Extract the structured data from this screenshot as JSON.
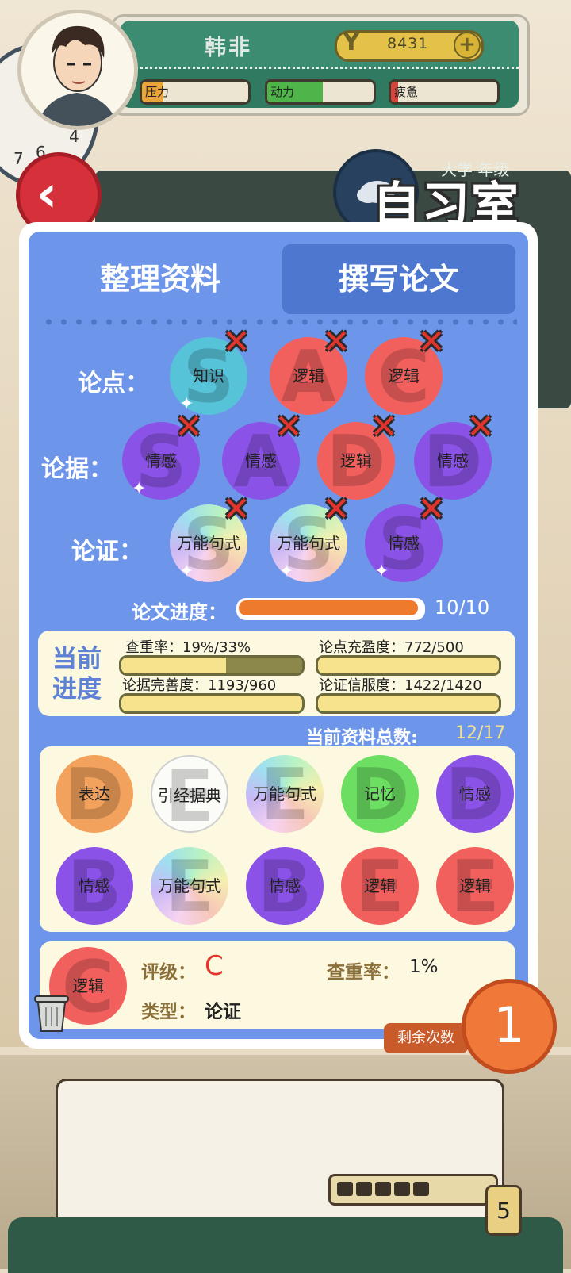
{
  "header": {
    "player_name": "韩非",
    "coin_symbol": "Y",
    "coins": "8431",
    "coin_plus": "+",
    "stats": [
      {
        "label": "压力",
        "color": "#e7a53a",
        "level": 0.2
      },
      {
        "label": "动力",
        "color": "#4fb54a",
        "level": 0.52
      },
      {
        "label": "疲惫",
        "color": "#d8443c",
        "level": 0.07
      }
    ]
  },
  "location": {
    "room": "自习室",
    "grade_text": "大学 年级"
  },
  "tabs": [
    {
      "label": "整理资料",
      "active": false
    },
    {
      "label": "撰写论文",
      "active": true
    }
  ],
  "essay": {
    "rows": [
      {
        "label": "论点：",
        "chips": [
          {
            "text": "知识",
            "grade": "S",
            "color": "cyan"
          },
          {
            "text": "逻辑",
            "grade": "A",
            "color": "red"
          },
          {
            "text": "逻辑",
            "grade": "C",
            "color": "red"
          }
        ]
      },
      {
        "label": "论据：",
        "chips": [
          {
            "text": "情感",
            "grade": "S",
            "color": "purple"
          },
          {
            "text": "情感",
            "grade": "A",
            "color": "purple"
          },
          {
            "text": "逻辑",
            "grade": "D",
            "color": "red"
          },
          {
            "text": "情感",
            "grade": "D",
            "color": "purple"
          }
        ]
      },
      {
        "label": "论证：",
        "chips": [
          {
            "text": "万能句式",
            "grade": "S",
            "color": "rainbow"
          },
          {
            "text": "万能句式",
            "grade": "S",
            "color": "rainbow"
          },
          {
            "text": "情感",
            "grade": "S",
            "color": "purple"
          }
        ]
      }
    ],
    "progress_label": "论文进度：",
    "progress_value": "10/10",
    "progress": 1.0
  },
  "current": {
    "title": "当前进度",
    "metrics": [
      {
        "label": "查重率：",
        "value": "19%/33%",
        "fill": 0.58
      },
      {
        "label": "论点充盈度：",
        "value": "772/500",
        "fill": 1.0
      },
      {
        "label": "论据完善度：",
        "value": "1193/960",
        "fill": 1.0
      },
      {
        "label": "论证信服度：",
        "value": "1422/1420",
        "fill": 1.0
      }
    ]
  },
  "materials": {
    "total_label": "当前资料总数:",
    "total_value": "12/17",
    "items": [
      {
        "text": "表达",
        "grade": "D",
        "color": "orange"
      },
      {
        "text": "引经据典",
        "grade": "E",
        "color": "white"
      },
      {
        "text": "万能句式",
        "grade": "E",
        "color": "rainbow"
      },
      {
        "text": "记忆",
        "grade": "D",
        "color": "green"
      },
      {
        "text": "情感",
        "grade": "D",
        "color": "purple"
      },
      {
        "text": "情感",
        "grade": "B",
        "color": "purple"
      },
      {
        "text": "万能句式",
        "grade": "E",
        "color": "rainbow"
      },
      {
        "text": "情感",
        "grade": "B",
        "color": "purple"
      },
      {
        "text": "逻辑",
        "grade": "E",
        "color": "red"
      },
      {
        "text": "逻辑",
        "grade": "E",
        "color": "red"
      }
    ]
  },
  "selected": {
    "text": "逻辑",
    "grade": "C",
    "color": "red",
    "grade_label": "评级：",
    "grade_value": "C",
    "dup_label": "查重率：",
    "dup_value": "1%",
    "type_label": "类型：",
    "type_value": "论证"
  },
  "remaining": {
    "label": "剩余次数",
    "count": "1"
  },
  "battery": {
    "cells": 5,
    "number": "5"
  }
}
